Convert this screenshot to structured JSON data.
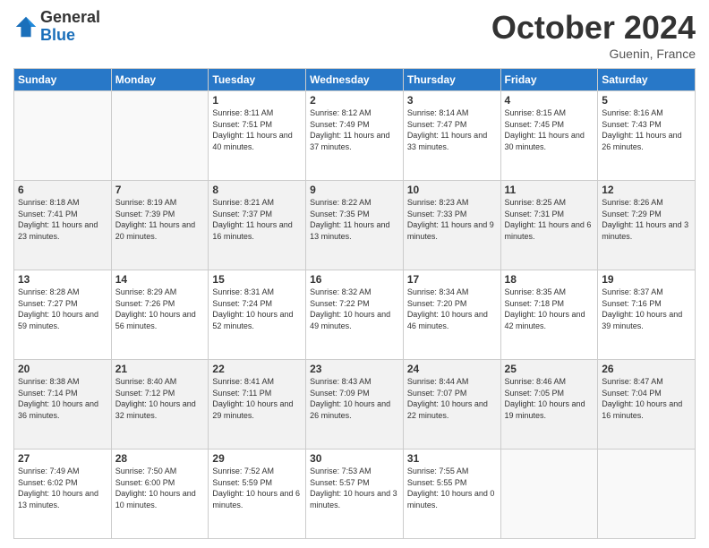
{
  "logo": {
    "general": "General",
    "blue": "Blue"
  },
  "header": {
    "month": "October 2024",
    "location": "Guenin, France"
  },
  "weekdays": [
    "Sunday",
    "Monday",
    "Tuesday",
    "Wednesday",
    "Thursday",
    "Friday",
    "Saturday"
  ],
  "weeks": [
    [
      {
        "day": "",
        "info": ""
      },
      {
        "day": "",
        "info": ""
      },
      {
        "day": "1",
        "info": "Sunrise: 8:11 AM\nSunset: 7:51 PM\nDaylight: 11 hours and 40 minutes."
      },
      {
        "day": "2",
        "info": "Sunrise: 8:12 AM\nSunset: 7:49 PM\nDaylight: 11 hours and 37 minutes."
      },
      {
        "day": "3",
        "info": "Sunrise: 8:14 AM\nSunset: 7:47 PM\nDaylight: 11 hours and 33 minutes."
      },
      {
        "day": "4",
        "info": "Sunrise: 8:15 AM\nSunset: 7:45 PM\nDaylight: 11 hours and 30 minutes."
      },
      {
        "day": "5",
        "info": "Sunrise: 8:16 AM\nSunset: 7:43 PM\nDaylight: 11 hours and 26 minutes."
      }
    ],
    [
      {
        "day": "6",
        "info": "Sunrise: 8:18 AM\nSunset: 7:41 PM\nDaylight: 11 hours and 23 minutes."
      },
      {
        "day": "7",
        "info": "Sunrise: 8:19 AM\nSunset: 7:39 PM\nDaylight: 11 hours and 20 minutes."
      },
      {
        "day": "8",
        "info": "Sunrise: 8:21 AM\nSunset: 7:37 PM\nDaylight: 11 hours and 16 minutes."
      },
      {
        "day": "9",
        "info": "Sunrise: 8:22 AM\nSunset: 7:35 PM\nDaylight: 11 hours and 13 minutes."
      },
      {
        "day": "10",
        "info": "Sunrise: 8:23 AM\nSunset: 7:33 PM\nDaylight: 11 hours and 9 minutes."
      },
      {
        "day": "11",
        "info": "Sunrise: 8:25 AM\nSunset: 7:31 PM\nDaylight: 11 hours and 6 minutes."
      },
      {
        "day": "12",
        "info": "Sunrise: 8:26 AM\nSunset: 7:29 PM\nDaylight: 11 hours and 3 minutes."
      }
    ],
    [
      {
        "day": "13",
        "info": "Sunrise: 8:28 AM\nSunset: 7:27 PM\nDaylight: 10 hours and 59 minutes."
      },
      {
        "day": "14",
        "info": "Sunrise: 8:29 AM\nSunset: 7:26 PM\nDaylight: 10 hours and 56 minutes."
      },
      {
        "day": "15",
        "info": "Sunrise: 8:31 AM\nSunset: 7:24 PM\nDaylight: 10 hours and 52 minutes."
      },
      {
        "day": "16",
        "info": "Sunrise: 8:32 AM\nSunset: 7:22 PM\nDaylight: 10 hours and 49 minutes."
      },
      {
        "day": "17",
        "info": "Sunrise: 8:34 AM\nSunset: 7:20 PM\nDaylight: 10 hours and 46 minutes."
      },
      {
        "day": "18",
        "info": "Sunrise: 8:35 AM\nSunset: 7:18 PM\nDaylight: 10 hours and 42 minutes."
      },
      {
        "day": "19",
        "info": "Sunrise: 8:37 AM\nSunset: 7:16 PM\nDaylight: 10 hours and 39 minutes."
      }
    ],
    [
      {
        "day": "20",
        "info": "Sunrise: 8:38 AM\nSunset: 7:14 PM\nDaylight: 10 hours and 36 minutes."
      },
      {
        "day": "21",
        "info": "Sunrise: 8:40 AM\nSunset: 7:12 PM\nDaylight: 10 hours and 32 minutes."
      },
      {
        "day": "22",
        "info": "Sunrise: 8:41 AM\nSunset: 7:11 PM\nDaylight: 10 hours and 29 minutes."
      },
      {
        "day": "23",
        "info": "Sunrise: 8:43 AM\nSunset: 7:09 PM\nDaylight: 10 hours and 26 minutes."
      },
      {
        "day": "24",
        "info": "Sunrise: 8:44 AM\nSunset: 7:07 PM\nDaylight: 10 hours and 22 minutes."
      },
      {
        "day": "25",
        "info": "Sunrise: 8:46 AM\nSunset: 7:05 PM\nDaylight: 10 hours and 19 minutes."
      },
      {
        "day": "26",
        "info": "Sunrise: 8:47 AM\nSunset: 7:04 PM\nDaylight: 10 hours and 16 minutes."
      }
    ],
    [
      {
        "day": "27",
        "info": "Sunrise: 7:49 AM\nSunset: 6:02 PM\nDaylight: 10 hours and 13 minutes."
      },
      {
        "day": "28",
        "info": "Sunrise: 7:50 AM\nSunset: 6:00 PM\nDaylight: 10 hours and 10 minutes."
      },
      {
        "day": "29",
        "info": "Sunrise: 7:52 AM\nSunset: 5:59 PM\nDaylight: 10 hours and 6 minutes."
      },
      {
        "day": "30",
        "info": "Sunrise: 7:53 AM\nSunset: 5:57 PM\nDaylight: 10 hours and 3 minutes."
      },
      {
        "day": "31",
        "info": "Sunrise: 7:55 AM\nSunset: 5:55 PM\nDaylight: 10 hours and 0 minutes."
      },
      {
        "day": "",
        "info": ""
      },
      {
        "day": "",
        "info": ""
      }
    ]
  ]
}
